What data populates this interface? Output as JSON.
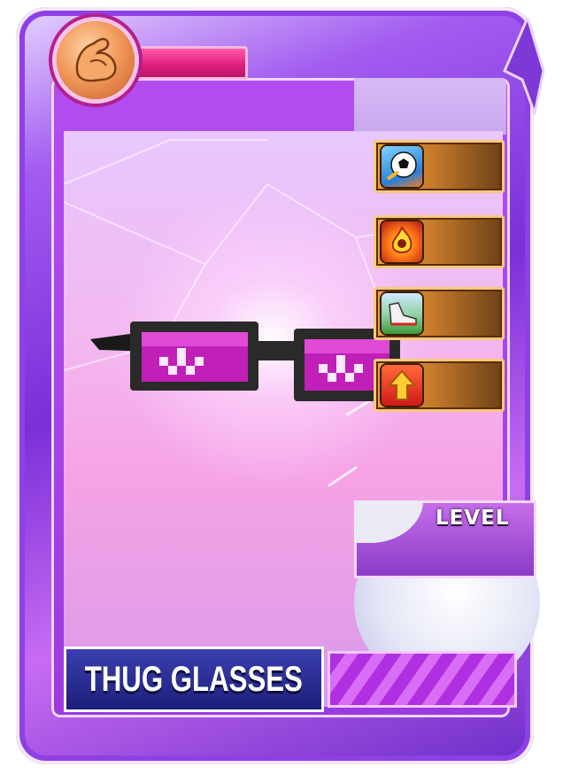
{
  "card": {
    "item_name": "THUG GLASSES",
    "level_label": "LEVEL",
    "power_icon": "flexed-bicep-icon"
  },
  "stats": [
    {
      "icon": "soccer-ball-shot-icon"
    },
    {
      "icon": "fire-player-icon"
    },
    {
      "icon": "football-boot-icon"
    },
    {
      "icon": "boost-up-arrow-icon"
    }
  ],
  "colors": {
    "frame_purple": "#7a2fd8",
    "power_bar_pink": "#e31f7e",
    "stat_orange": "#f0a244",
    "name_plate_blue": "#1c1f7a"
  }
}
